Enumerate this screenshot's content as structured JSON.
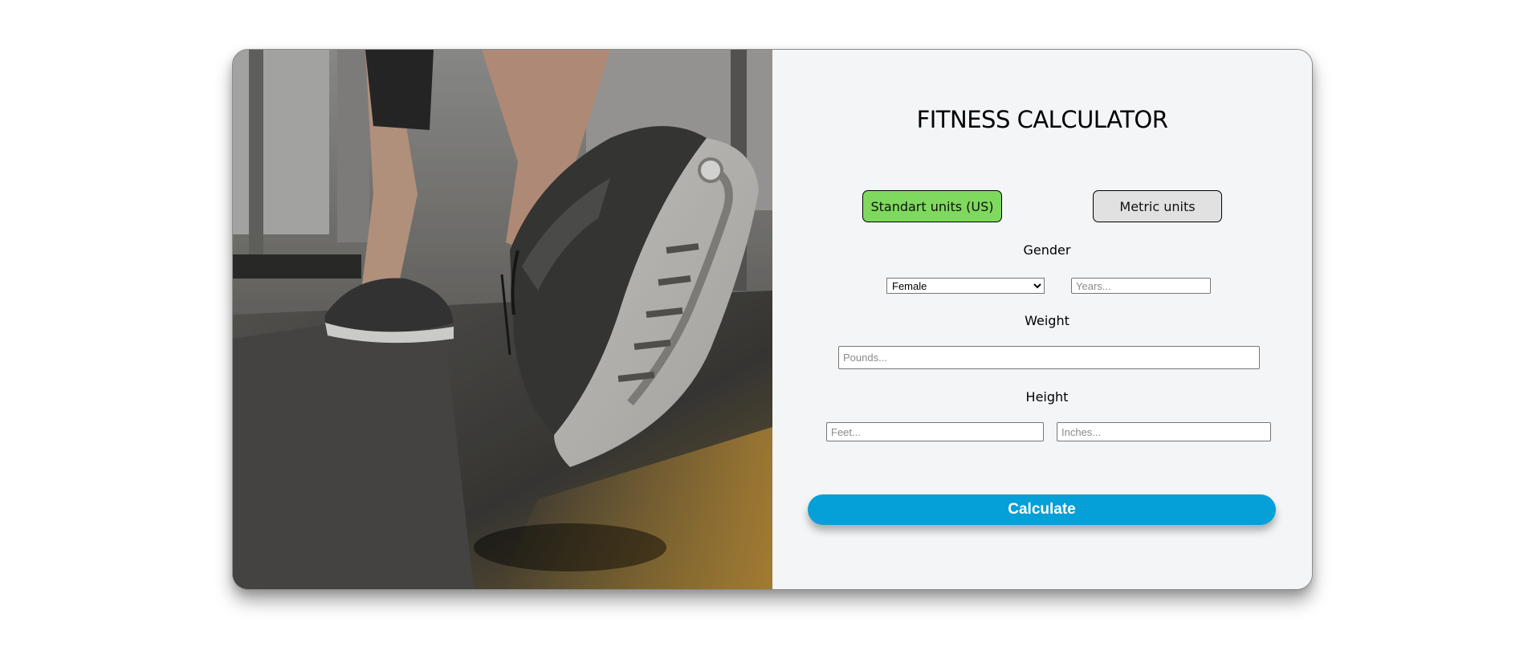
{
  "page": {
    "title": "FITNESS CALCULATOR",
    "hero_image": "running-shoe-on-treadmill"
  },
  "units": {
    "standard_label": "Standart units (US)",
    "metric_label": "Metric units",
    "active": "standard",
    "active_color": "#7fd95e",
    "inactive_color": "#e1e1e1"
  },
  "gender": {
    "label": "Gender",
    "selected": "Female",
    "age_placeholder": "Years..."
  },
  "weight": {
    "label": "Weight",
    "placeholder": "Pounds..."
  },
  "height": {
    "label": "Height",
    "feet_placeholder": "Feet...",
    "inches_placeholder": "Inches..."
  },
  "actions": {
    "calculate_label": "Calculate",
    "calculate_color": "#05a0d8"
  }
}
